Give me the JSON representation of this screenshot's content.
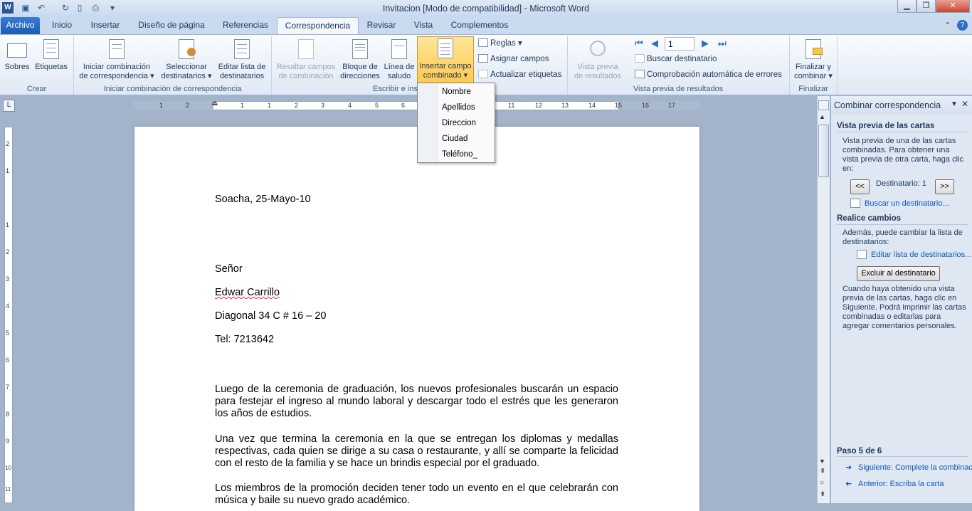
{
  "window": {
    "title": "Invitacion [Modo de compatibilidad]  -  Microsoft Word"
  },
  "tabs": [
    "Archivo",
    "Inicio",
    "Insertar",
    "Diseño de página",
    "Referencias",
    "Correspondencia",
    "Revisar",
    "Vista",
    "Complementos"
  ],
  "ribbon": {
    "crear": {
      "label": "Crear",
      "sobres": "Sobres",
      "etiquetas": "Etiquetas"
    },
    "iniciar": {
      "label": "Iniciar combinación de correspondencia",
      "iniciar_l1": "Iniciar combinación",
      "iniciar_l2": "de correspondencia",
      "seleccionar_l1": "Seleccionar",
      "seleccionar_l2": "destinatarios",
      "editar_l1": "Editar lista de",
      "editar_l2": "destinatarios"
    },
    "escribir": {
      "label": "Escribir e ins",
      "resaltar_l1": "Resaltar campos",
      "resaltar_l2": "de combinación",
      "bloque_l1": "Bloque de",
      "bloque_l2": "direcciones",
      "linea_l1": "Línea de",
      "linea_l2": "saludo",
      "insertar_l1": "Insertar campo",
      "insertar_l2": "combinado",
      "reglas": "Reglas",
      "asignar": "Asignar campos",
      "actualizar": "Actualizar etiquetas"
    },
    "vista": {
      "label": "Vista previa de resultados",
      "vista_l1": "Vista previa",
      "vista_l2": "de resultados",
      "record": "1",
      "buscar": "Buscar destinatario",
      "comprobacion": "Comprobación automática de errores"
    },
    "finalizar": {
      "label": "Finalizar",
      "fin_l1": "Finalizar y",
      "fin_l2": "combinar"
    }
  },
  "dropdown": [
    "Nombre",
    "Apellidos",
    "Direccion",
    "Ciudad",
    "Teléfono_"
  ],
  "ruler": [
    "1",
    "2",
    "1",
    "1",
    "2",
    "3",
    "4",
    "5",
    "6",
    "11",
    "12",
    "13",
    "14",
    "15",
    "16",
    "17"
  ],
  "vruler": [
    "2",
    "1",
    "1",
    "2",
    "3",
    "4",
    "5",
    "6",
    "7",
    "8",
    "9",
    "10",
    "11"
  ],
  "document": {
    "date": "Soacha, 25-Mayo-10",
    "l1": "Señor",
    "l2": "Edwar Carrillo",
    "l3": "Diagonal 34 C # 16 – 20",
    "l4": "Tel: 7213642",
    "p1": "Luego de la ceremonia de graduación, los nuevos profesionales buscarán un espacio para festejar el ingreso al mundo laboral y descargar todo el estrés que les generaron los años de estudios.",
    "p2": "Una vez que termina la ceremonia en la que se entregan los diplomas y medallas respectivas, cada quien se dirige a su casa o restaurante, y allí se comparte la felicidad con el resto de la familia y se hace un brindis especial por el graduado.",
    "p3": "Los miembros de la promoción deciden tener todo un evento en el que celebrarán con música y baile su nuevo grado académico."
  },
  "taskpane": {
    "title": "Combinar correspondencia",
    "h1": "Vista previa de las cartas",
    "t1": "Vista previa de una de las cartas combinadas. Para obtener una vista previa de otra carta, haga clic en:",
    "prev": "<<",
    "dest": "Destinatario: 1",
    "next": ">>",
    "buscar": "Buscar un destinatario...",
    "h2": "Realice cambios",
    "t2": "Además, puede cambiar la lista de destinatarios:",
    "editar": "Editar lista de destinatarios...",
    "excluir": "Excluir al destinatario",
    "t3": "Cuando haya obtenido una vista previa de las cartas, haga clic en Siguiente. Podrá imprimir las cartas combinadas o editarlas para agregar comentarios personales.",
    "paso": "Paso 5 de 6",
    "siguiente": "Siguiente: Complete la combinación",
    "anterior": "Anterior: Escriba la carta"
  }
}
